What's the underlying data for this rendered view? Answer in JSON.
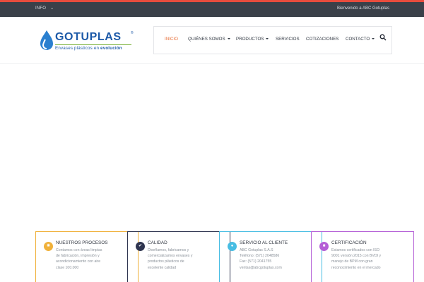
{
  "topbar": {
    "info_label": "INFO",
    "welcome_text": "Bienvenido a ABC Gotuplas"
  },
  "logo": {
    "brand": "GOTUPLAS",
    "registered": "®",
    "tagline_prefix": "Envases plásticos en ",
    "tagline_bold": "evolución"
  },
  "nav": {
    "items": [
      {
        "label": "INICIO"
      },
      {
        "label": "QUIÉNES SOMOS"
      },
      {
        "label": "PRODUCTOS"
      },
      {
        "label": "SERVICIOS"
      },
      {
        "label": "COTIZACIONES"
      },
      {
        "label": "CONTACTO"
      }
    ],
    "search_icon": "search-icon"
  },
  "colors": {
    "accent_top": "#e84c3d",
    "topbar_bg": "#3a4049",
    "brand_blue": "#1d5aa8",
    "active_nav": "#e8703a"
  },
  "cards": [
    {
      "title": "NUESTROS PROCESOS",
      "color": "#f0b13a",
      "icon": "gear-icon",
      "lines": [
        "Contamos con áreas limpias",
        "de fabricación, impresión y",
        "acondicionamiento con aire",
        "clase 100.000"
      ]
    },
    {
      "title": "CALIDAD",
      "color": "#2f3550",
      "icon": "thumbs-up-icon",
      "lines": [
        "Diseñamos, fabricamos y",
        "comercializamos envases y",
        "productos plásticos de",
        "excelente calidad"
      ]
    },
    {
      "title": "SERVICIO AL CLIENTE",
      "color": "#48bde3",
      "icon": "user-icon",
      "lines": [
        "ABC Gotuplas S.A.S",
        "Teléfono: (571) 2048586",
        "Fax: (571) 2041755",
        "ventas@abcgotuplas.com"
      ]
    },
    {
      "title": "CERTIFICACIÓN",
      "color": "#b45fd6",
      "icon": "certificate-icon",
      "lines": [
        "Estamos certificados con ISO",
        "9001 versión 2015 con BVDI y",
        "manejo de BPM con gran",
        "reconocimiento en el mercado"
      ]
    }
  ]
}
